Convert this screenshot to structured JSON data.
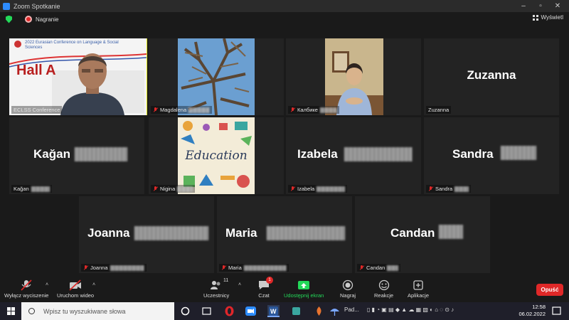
{
  "window": {
    "title": "Zoom Spotkanie"
  },
  "topbar": {
    "recording_label": "Nagranie",
    "view_label": "Wyświetl"
  },
  "slide": {
    "conference_text": "2022 Eurasian Conference on Language & Social Sciences",
    "hall_word": "Hall",
    "hall_letter": "A"
  },
  "tiles": {
    "t1": {
      "name": "ECLSS Conference"
    },
    "t2": {
      "name": "Magdalena"
    },
    "t3": {
      "name": "Калбике"
    },
    "t4": {
      "big": "Zuzanna",
      "name": "Zuzanna"
    },
    "t5": {
      "big": "Kağan",
      "name": "Kağan"
    },
    "t6": {
      "name": "Nigina",
      "image_text": "Education"
    },
    "t7": {
      "big": "Izabela",
      "name": "Izabela"
    },
    "t8": {
      "big": "Sandra",
      "name": "Sandra"
    },
    "t9": {
      "big": "Joanna",
      "name": "Joanna"
    },
    "t10": {
      "big": "Maria",
      "name": "Maria"
    },
    "t11": {
      "big": "Candan",
      "name": "Candan"
    }
  },
  "toolbar": {
    "mute": "Wyłącz wyciszenie",
    "video": "Uruchom wideo",
    "participants": "Uczestnicy",
    "participants_count": "11",
    "chat": "Czat",
    "chat_badge": "1",
    "share": "Udostępnij ekran",
    "record": "Nagraj",
    "reactions": "Reakcje",
    "apps": "Aplikacje",
    "end": "Opuść"
  },
  "taskbar": {
    "search_placeholder": "Wpisz tu wyszukiwane słowa",
    "weather": "Pad...",
    "time": "12:58",
    "date": "06.02.2022"
  },
  "colors": {
    "accent_green": "#23d959",
    "end_red": "#e02828",
    "active_speaker": "#e0e61a"
  }
}
